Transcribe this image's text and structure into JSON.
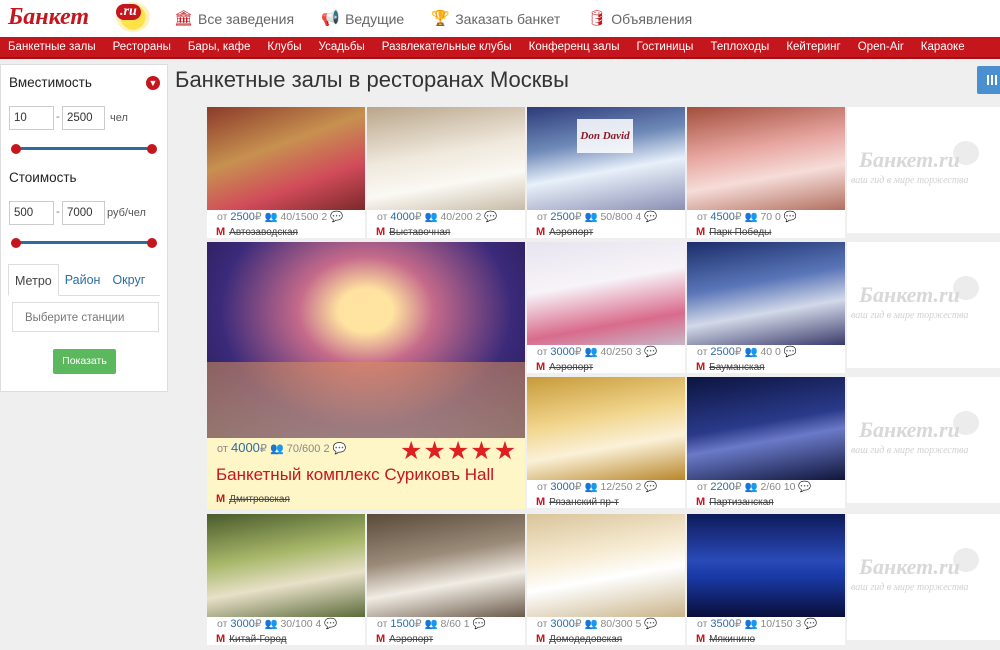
{
  "header": {
    "logo": "Банкет",
    "logo_ru": ".ru",
    "nav": [
      {
        "label": "Все заведения",
        "icon": "building-icon"
      },
      {
        "label": "Ведущие",
        "icon": "megaphone-icon"
      },
      {
        "label": "Заказать банкет",
        "icon": "trophy-icon"
      },
      {
        "label": "Объявления",
        "icon": "database-icon"
      }
    ]
  },
  "menu": [
    "Банкетные залы",
    "Рестораны",
    "Бары, кафе",
    "Клубы",
    "Усадьбы",
    "Развлекательные клубы",
    "Конференц залы",
    "Гостиницы",
    "Теплоходы",
    "Кейтеринг",
    "Open-Air",
    "Караоке"
  ],
  "filters": {
    "capacity": {
      "label": "Вместимость",
      "min": "10",
      "max": "2500",
      "unit": "чел"
    },
    "cost": {
      "label": "Стоимость",
      "min": "500",
      "max": "7000",
      "unit": "руб/чел"
    },
    "tabs": [
      "Метро",
      "Район",
      "Округ"
    ],
    "station_placeholder": "Выберите станции",
    "show_button": "Показать"
  },
  "page_title": "Банкетные залы в ресторанах Москвы",
  "watermark": {
    "text": "Банкет",
    "ru": ".ru",
    "slogan": "ваш гид в мире торжества"
  },
  "cards": [
    {
      "price_prefix": "от",
      "price": "2500",
      "cap": "40/1500",
      "reviews": "2",
      "metro": "Автозаводская"
    },
    {
      "price_prefix": "от",
      "price": "4000",
      "cap": "40/200",
      "reviews": "2",
      "metro": "Выставочная"
    },
    {
      "price_prefix": "от",
      "price": "2500",
      "cap": "50/800",
      "reviews": "4",
      "metro": "Аэропорт",
      "brand": "Don David"
    },
    {
      "price_prefix": "от",
      "price": "4500",
      "cap": "70",
      "reviews": "0",
      "metro": "Парк Победы"
    },
    {
      "price_prefix": "от",
      "price": "3000",
      "cap": "40/250",
      "reviews": "3",
      "metro": "Аэропорт"
    },
    {
      "price_prefix": "от",
      "price": "2500",
      "cap": "40",
      "reviews": "0",
      "metro": "Бауманская"
    },
    {
      "price_prefix": "от",
      "price": "3000",
      "cap": "12/250",
      "reviews": "2",
      "metro": "Рязанский пр-т"
    },
    {
      "price_prefix": "от",
      "price": "2200",
      "cap": "2/60",
      "reviews": "10",
      "metro": "Партизанская"
    },
    {
      "price_prefix": "от",
      "price": "3000",
      "cap": "30/100",
      "reviews": "4",
      "metro": "Китай-Город"
    },
    {
      "price_prefix": "от",
      "price": "1500",
      "cap": "8/60",
      "reviews": "1",
      "metro": "Аэропорт"
    },
    {
      "price_prefix": "от",
      "price": "3000",
      "cap": "80/300",
      "reviews": "5",
      "metro": "Домодедовская"
    },
    {
      "price_prefix": "от",
      "price": "3500",
      "cap": "10/150",
      "reviews": "3",
      "metro": "Мякинино"
    }
  ],
  "featured": {
    "price_prefix": "от",
    "price": "4000",
    "cap": "70/600",
    "reviews": "2",
    "rating": 5,
    "name": "Банкетный комплекс Суриковъ Hall",
    "metro": "Дмитровская"
  }
}
